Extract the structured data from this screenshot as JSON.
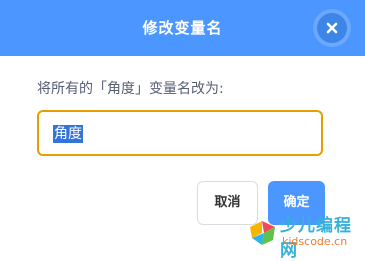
{
  "dialog": {
    "title": "修改变量名",
    "prompt": "将所有的「角度」变量名改为:",
    "input": {
      "value": "角度",
      "selected": true
    },
    "buttons": {
      "cancel": "取消",
      "ok": "确定"
    }
  },
  "watermark": {
    "title": "少儿编程网",
    "url": "kidscode.cn"
  },
  "colors": {
    "header": "#4c97ff",
    "field_border": "#e5a000",
    "selection": "#3474d8",
    "ok_button": "#4c97ff"
  },
  "icons": {
    "close": "close-icon",
    "logo": "kidscode-logo-icon"
  }
}
